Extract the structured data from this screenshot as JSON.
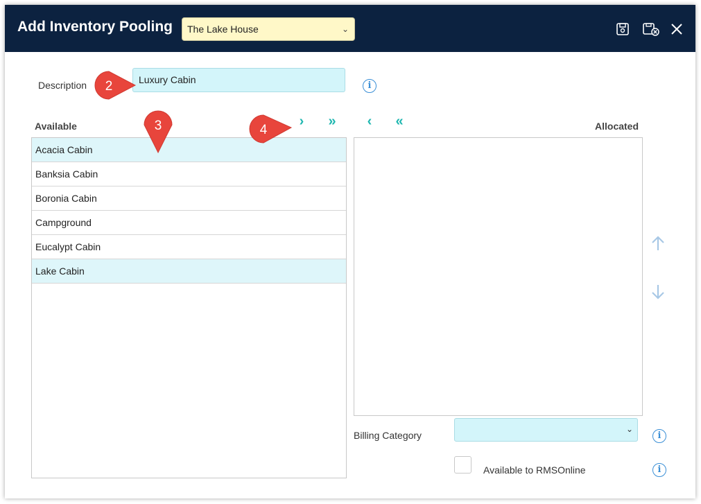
{
  "dialog": {
    "title": "Add Inventory Pooling",
    "property_select": {
      "value": "The Lake House"
    },
    "icons": [
      "save-icon",
      "save-and-close-icon",
      "close-icon"
    ]
  },
  "form": {
    "description_label": "Description",
    "description_value": "Luxury Cabin",
    "available_heading": "Available",
    "allocated_heading": "Allocated",
    "available_items": [
      {
        "label": "Acacia Cabin",
        "selected": true
      },
      {
        "label": "Banksia Cabin",
        "selected": false
      },
      {
        "label": "Boronia Cabin",
        "selected": false
      },
      {
        "label": "Campground",
        "selected": false
      },
      {
        "label": "Eucalypt Cabin",
        "selected": false
      },
      {
        "label": "Lake Cabin",
        "selected": true
      }
    ],
    "allocated_items": [],
    "transfer_buttons": {
      "move_selected_right": "›",
      "move_all_right": "»",
      "move_selected_left": "‹",
      "move_all_left": "«"
    },
    "billing_category_label": "Billing Category",
    "billing_category_value": "",
    "available_online_label": "Available to RMSOnline",
    "available_online_checked": false
  },
  "callouts": [
    "2",
    "3",
    "4"
  ],
  "colors": {
    "titlebar": "#0c2240",
    "property_select_bg": "#fff8c8",
    "input_bg": "#d3f5fa",
    "selected_row": "#def6fa",
    "arrow_accent": "#1fb7b0",
    "callout_red": "#e8453c",
    "info_blue": "#3a8fd6"
  }
}
